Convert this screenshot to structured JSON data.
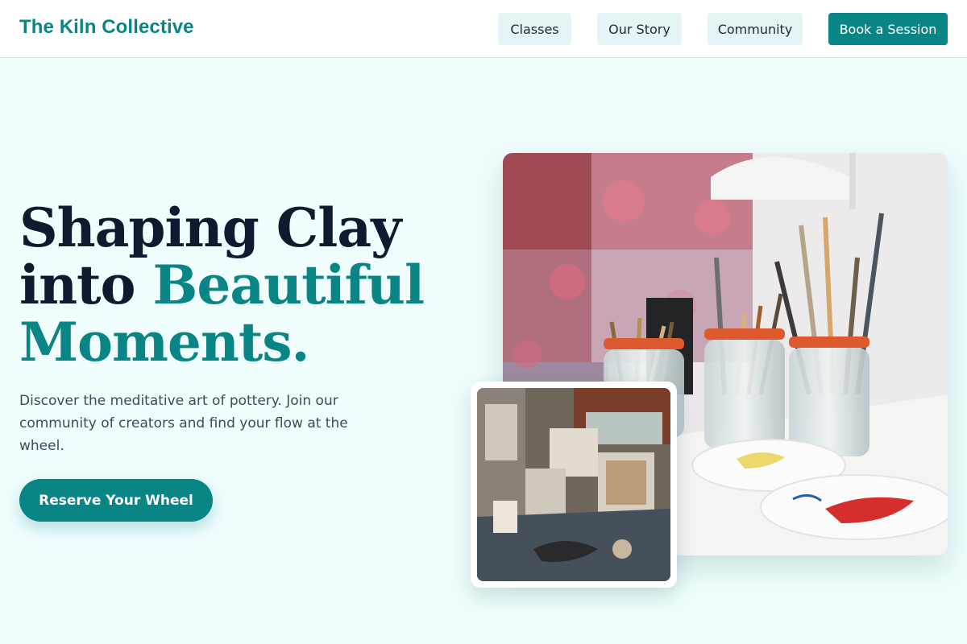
{
  "header": {
    "brand": "The Kiln Collective",
    "nav": {
      "classes": "Classes",
      "story": "Our Story",
      "community": "Community",
      "book": "Book a Session"
    }
  },
  "hero": {
    "headline_line1": "Shaping Clay",
    "headline_line2_prefix": "into ",
    "headline_line2_accent": "Beautiful",
    "headline_line3_accent": "Moments.",
    "subtext": "Discover the meditative art of pottery. Join our community of creators and find your flow at the wheel.",
    "cta": "Reserve Your Wheel"
  },
  "images": {
    "main": "paint-brushes-in-jars-photo",
    "inset": "art-studio-overhead-photo"
  },
  "colors": {
    "accent": "#0a8585",
    "background": "#effdfd",
    "heading": "#0f1a2e"
  }
}
